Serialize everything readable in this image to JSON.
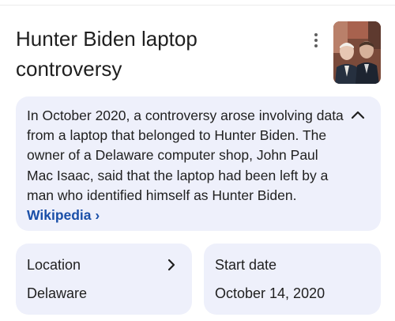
{
  "title": "Hunter Biden laptop controversy",
  "description": {
    "text": "In October 2020, a controversy arose involving data from a laptop that belonged to Hunter Biden. The owner of a Delaware computer shop, John Paul Mac Isaac, said that the laptop had been left by a man who identified himself as Hunter Biden. ",
    "source_link": "Wikipedia ›"
  },
  "facts": [
    {
      "label": "Location",
      "value": "Delaware"
    },
    {
      "label": "Start date",
      "value": "October 14, 2020"
    }
  ],
  "icons": {
    "menu": "more-vert-icon",
    "collapse": "chevron-up-icon",
    "expand": "chevron-right-icon"
  },
  "colors": {
    "card_bg": "#eef0fb",
    "link": "#1a4fa8",
    "text": "#1f1f1f"
  }
}
